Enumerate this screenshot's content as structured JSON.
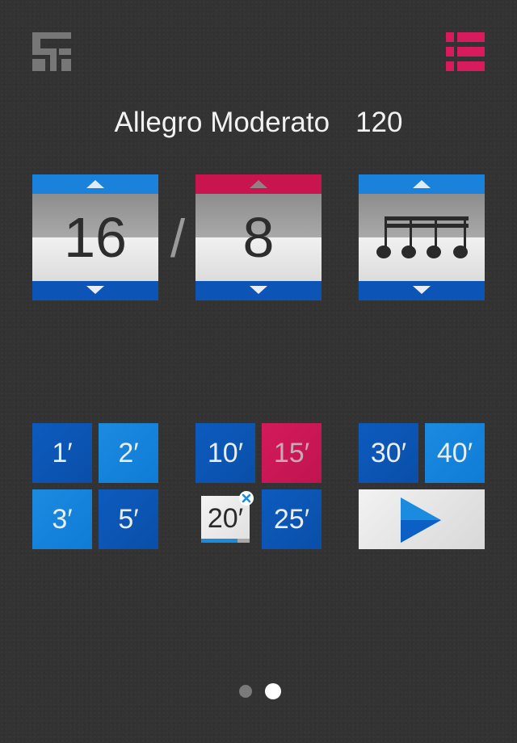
{
  "header": {
    "logo_icon": "app-logo-icon",
    "menu_icon": "list-menu-icon",
    "menu_color": "#d81b5c"
  },
  "tempo": {
    "name": "Allegro Moderato",
    "bpm": "120"
  },
  "time_signature": {
    "numerator": "16",
    "separator": "/",
    "denominator": "8"
  },
  "subdivision_picker": {
    "icon": "sixteenth-notes-icon"
  },
  "durations": {
    "group1": [
      "1′",
      "2′",
      "3′",
      "5′"
    ],
    "group2": [
      "10′",
      "15′",
      "20′",
      "25′"
    ],
    "group3": [
      "30′",
      "40′"
    ],
    "selected": "15′",
    "running": {
      "label": "20′",
      "progress": 0.75,
      "close_icon": "close-icon"
    },
    "play_icon": "play-icon"
  },
  "pager": {
    "pages": 2,
    "current": 2
  },
  "colors": {
    "blue_dark": "#0a52b0",
    "blue_light": "#1687de",
    "pink": "#d41a5b",
    "background": "#333333"
  }
}
